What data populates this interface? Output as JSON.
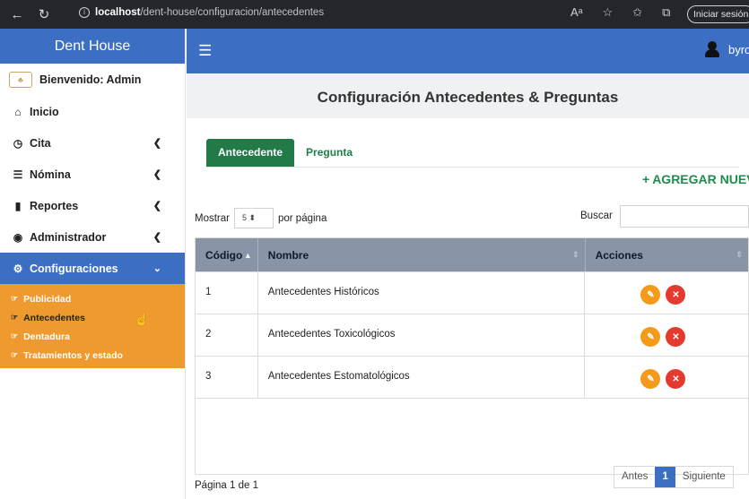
{
  "browser": {
    "url_host": "localhost",
    "url_path": "/dent-house/configuracion/antecedentes",
    "signin_label": "Iniciar sesión"
  },
  "sidebar": {
    "brand": "Dent House",
    "welcome": "Bienvenido: Admin",
    "items": [
      {
        "label": "Inicio",
        "icon": "home-icon"
      },
      {
        "label": "Cita",
        "icon": "clock-icon"
      },
      {
        "label": "Nómina",
        "icon": "list-icon"
      },
      {
        "label": "Reportes",
        "icon": "pdf-file-icon"
      },
      {
        "label": "Administrador",
        "icon": "lock-icon"
      },
      {
        "label": "Configuraciones",
        "icon": "cogs-icon"
      }
    ],
    "subitems": [
      "Publicidad",
      "Antecedentes",
      "Dentadura",
      "Tratamientos y estado"
    ]
  },
  "topbar": {
    "user": "byron"
  },
  "page": {
    "title": "Configuración Antecedentes & Preguntas",
    "tabs": [
      "Antecedente",
      "Pregunta"
    ],
    "add_new": "AGREGAR NUEVO",
    "show_prefix": "Mostrar",
    "show_value": "5",
    "show_suffix": "por página",
    "search_label": "Buscar",
    "search_value": ""
  },
  "table": {
    "headers": [
      "Código",
      "Nombre",
      "Acciones"
    ],
    "rows": [
      {
        "codigo": "1",
        "nombre": "Antecedentes Históricos"
      },
      {
        "codigo": "2",
        "nombre": "Antecedentes Toxicológicos"
      },
      {
        "codigo": "3",
        "nombre": "Antecedentes Estomatológicos"
      }
    ]
  },
  "pagination": {
    "info": "Página 1 de 1",
    "prev": "Antes",
    "current": "1",
    "next": "Siguiente"
  },
  "colors": {
    "primary": "#3c6fc4",
    "submenu": "#ef9a2f",
    "tab_active": "#217a48",
    "edit": "#f39a1b",
    "delete": "#e53a2e"
  }
}
